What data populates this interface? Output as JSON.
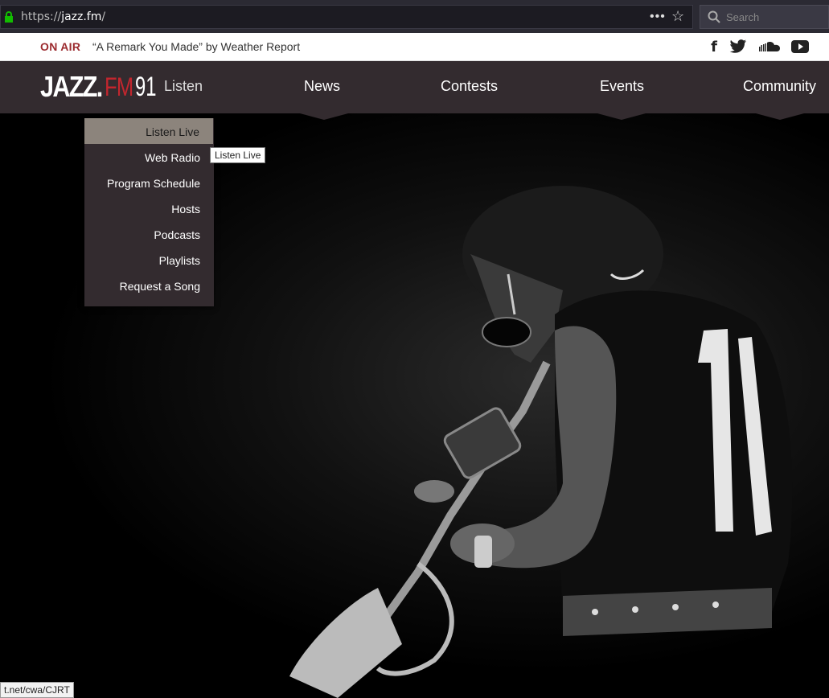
{
  "browser": {
    "url_scheme": "https://",
    "url_host": "jazz.fm",
    "url_path": "/",
    "more_icon": "more-icon",
    "bookmark_icon": "star-icon",
    "search_placeholder": "Search"
  },
  "onair": {
    "label": "ON AIR",
    "track": "“A Remark You Made” by Weather Report",
    "social": [
      "facebook-icon",
      "twitter-icon",
      "soundcloud-icon",
      "youtube-icon"
    ]
  },
  "nav": {
    "logo_jazz": "JAZZ.",
    "logo_fm": "FM",
    "logo_91": "91",
    "items": [
      "Listen",
      "News",
      "Contests",
      "Events",
      "Community"
    ]
  },
  "dropdown": {
    "items": [
      "Listen Live",
      "Web Radio",
      "Program Schedule",
      "Hosts",
      "Podcasts",
      "Playlists",
      "Request a Song"
    ],
    "tooltip": "Listen Live"
  },
  "status_bar": {
    "text": "t.net/cwa/CJRT"
  },
  "colors": {
    "onair_red": "#9b2a2e",
    "nav_bg": "#332b2f",
    "dropdown_active_bg": "#8c847c"
  }
}
